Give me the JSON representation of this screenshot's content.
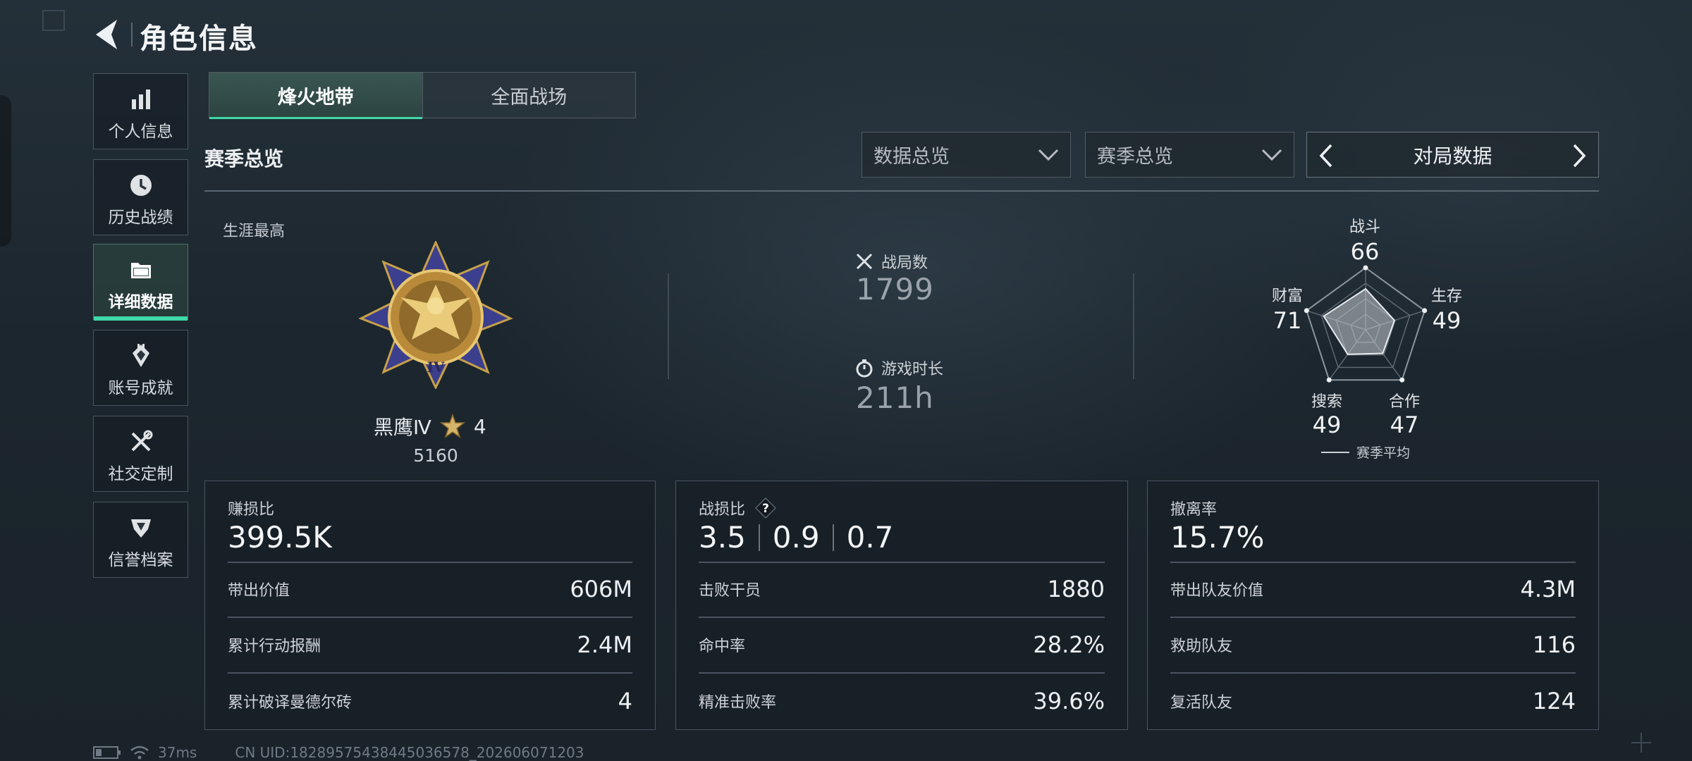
{
  "header": {
    "title": "角色信息"
  },
  "sidebar": {
    "items": [
      {
        "label": "个人信息",
        "icon": "bar-chart-icon"
      },
      {
        "label": "历史战绩",
        "icon": "clock-icon"
      },
      {
        "label": "详细数据",
        "icon": "folder-icon",
        "active": true
      },
      {
        "label": "账号成就",
        "icon": "achievement-icon"
      },
      {
        "label": "社交定制",
        "icon": "tools-icon"
      },
      {
        "label": "信誉档案",
        "icon": "shield-icon"
      }
    ]
  },
  "mode_tabs": [
    {
      "label": "烽火地带",
      "active": true
    },
    {
      "label": "全面战场",
      "active": false
    }
  ],
  "section_title": "赛季总览",
  "filters": {
    "data_dropdown": "数据总览",
    "season_dropdown": "赛季总览",
    "selector_label": "对局数据"
  },
  "career": {
    "label": "生涯最高",
    "rank_name": "黑鹰Ⅳ",
    "stars": "4",
    "points": "5160"
  },
  "summary": {
    "matches_label": "战局数",
    "matches_value": "1799",
    "playtime_label": "游戏时长",
    "playtime_value": "211h"
  },
  "radar": {
    "axes": [
      {
        "label": "战斗",
        "value": "66",
        "score": 0.66
      },
      {
        "label": "生存",
        "value": "49",
        "score": 0.49
      },
      {
        "label": "合作",
        "value": "47",
        "score": 0.47
      },
      {
        "label": "搜索",
        "value": "49",
        "score": 0.49
      },
      {
        "label": "财富",
        "value": "71",
        "score": 0.71
      }
    ],
    "legend": "赛季平均"
  },
  "panels": {
    "profit": {
      "title": "赚损比",
      "main": "399.5K",
      "rows": [
        {
          "label": "带出价值",
          "value": "606M"
        },
        {
          "label": "累计行动报酬",
          "value": "2.4M"
        },
        {
          "label": "累计破译曼德尔砖",
          "value": "4"
        }
      ]
    },
    "combat": {
      "title": "战损比",
      "help": "?",
      "values": [
        "3.5",
        "0.9",
        "0.7"
      ],
      "rows": [
        {
          "label": "击败干员",
          "value": "1880"
        },
        {
          "label": "命中率",
          "value": "28.2%"
        },
        {
          "label": "精准击败率",
          "value": "39.6%"
        }
      ]
    },
    "extract": {
      "title": "撤离率",
      "main": "15.7%",
      "rows": [
        {
          "label": "带出队友价值",
          "value": "4.3M"
        },
        {
          "label": "救助队友",
          "value": "116"
        },
        {
          "label": "复活队友",
          "value": "124"
        }
      ]
    }
  },
  "footer": {
    "ping": "37ms",
    "uid": "CN UID:18289575438445036578_202606071203"
  },
  "colors": {
    "accent": "#3fd9a8",
    "panel_border": "#4a5560"
  }
}
